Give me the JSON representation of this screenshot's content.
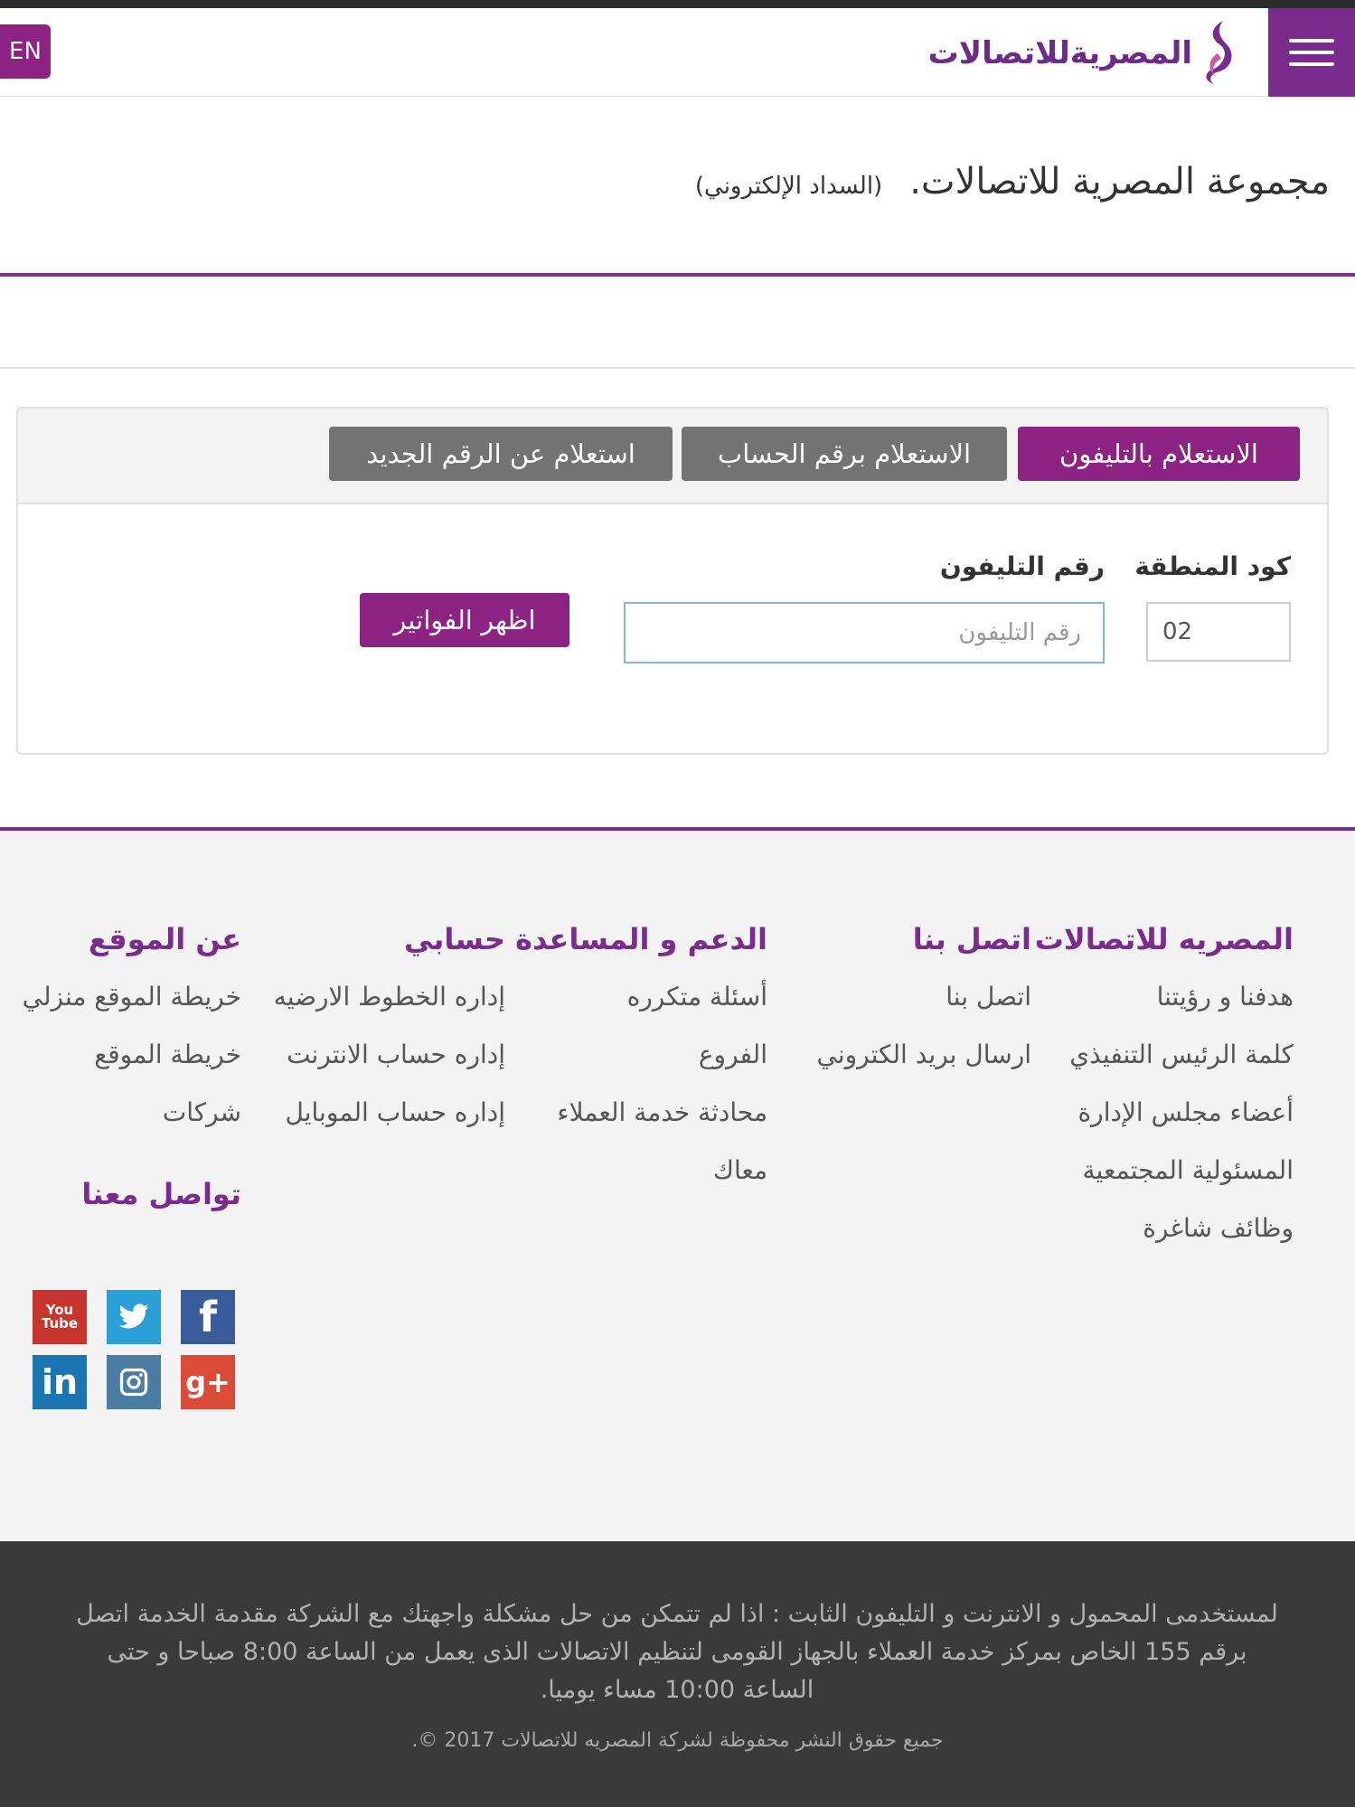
{
  "header": {
    "lang_label": "EN",
    "logo_text": "المصريةللاتصالات"
  },
  "page": {
    "title": "مجموعة المصرية للاتصالات.",
    "subtitle": "(السداد الإلكتروني)"
  },
  "tabs": [
    {
      "label": "الاستعلام بالتليفون",
      "active": true
    },
    {
      "label": "الاستعلام برقم الحساب",
      "active": false
    },
    {
      "label": "استعلام عن الرقم الجديد",
      "active": false
    }
  ],
  "form": {
    "area_code_label": "كود المنطقة",
    "area_code_value": "02",
    "phone_label": "رقم التليفون",
    "phone_placeholder": "رقم التليفون",
    "submit_label": "اظهر الفواتير"
  },
  "footer": {
    "columns": [
      {
        "heading": "المصريه للاتصالات",
        "items": [
          "هدفنا و رؤيتنا",
          "كلمة الرئيس التنفيذي",
          "أعضاء مجلس الإدارة",
          "المسئولية المجتمعية",
          "وظائف شاغرة"
        ]
      },
      {
        "heading": "اتصل بنا",
        "items": [
          "اتصل بنا",
          "ارسال بريد الكتروني"
        ]
      },
      {
        "heading": "الدعم و المساعدة",
        "items": [
          "أسئلة متكرره",
          "الفروع",
          "محادثة خدمة العملاء",
          "معاك"
        ]
      },
      {
        "heading": "حسابي",
        "items": [
          "إداره الخطوط الارضيه",
          "إداره حساب الانترنت",
          "إداره حساب الموبايل"
        ]
      },
      {
        "heading": "عن الموقع",
        "items": [
          "خريطة الموقع منزلي",
          "خريطة الموقع",
          "شركات"
        ]
      }
    ],
    "social_heading": "تواصل معنا",
    "social": [
      "youtube-icon",
      "twitter-icon",
      "facebook-icon",
      "linkedin-icon",
      "instagram-icon",
      "google-plus-icon"
    ]
  },
  "bottom": {
    "notice": "لمستخدمى المحمول و الانترنت و التليفون الثابت : اذا لم تتمكن من حل مشكلة واجهتك مع الشركة مقدمة الخدمة اتصل برقم 155 الخاص بمركز خدمة العملاء بالجهاز القومى لتنظيم الاتصالات الذى يعمل من الساعة 8:00 صباحا و حتى الساعة 10:00 مساء يوميا.",
    "copyright": "جميع حقوق النشر محفوظة لشركة المصريه للاتصالات 2017 ©."
  },
  "colors": {
    "brand": "#7a2c8c",
    "accent": "#8c2382",
    "tab_inactive": "#737373"
  }
}
